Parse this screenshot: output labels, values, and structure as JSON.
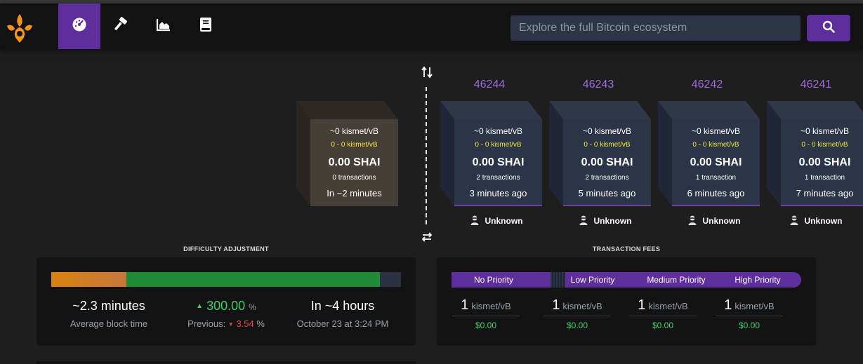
{
  "nav": {
    "items": [
      {
        "name": "dashboard-nav-button",
        "icon": "gauge-icon",
        "active": true
      },
      {
        "name": "mining-nav-button",
        "icon": "hammer-icon",
        "active": false
      },
      {
        "name": "graphs-nav-button",
        "icon": "chart-area-icon",
        "active": false
      },
      {
        "name": "docs-nav-button",
        "icon": "book-icon",
        "active": false
      }
    ],
    "accent": "#5e2f9c"
  },
  "search": {
    "placeholder": "Explore the full Bitcoin ecosystem"
  },
  "pending_block": {
    "fee": "~0 kismet/vB",
    "range": "0 - 0 kismet/vB",
    "amount": "0.00 SHAI",
    "txs": "0 transactions",
    "time": "In ~2 minutes"
  },
  "blocks": [
    {
      "height": "46244",
      "fee": "~0 kismet/vB",
      "range": "0 - 0 kismet/vB",
      "amount": "0.00 SHAI",
      "txs": "2 transactions",
      "time": "3 minutes ago",
      "miner": "Unknown"
    },
    {
      "height": "46243",
      "fee": "~0 kismet/vB",
      "range": "0 - 0 kismet/vB",
      "amount": "0.00 SHAI",
      "txs": "2 transactions",
      "time": "5 minutes ago",
      "miner": "Unknown"
    },
    {
      "height": "46242",
      "fee": "~0 kismet/vB",
      "range": "0 - 0 kismet/vB",
      "amount": "0.00 SHAI",
      "txs": "1 transaction",
      "time": "6 minutes ago",
      "miner": "Unknown"
    },
    {
      "height": "46241",
      "fee": "~0 kismet/vB",
      "range": "0 - 0 kismet/vB",
      "amount": "0.00 SHAI",
      "txs": "1 transaction",
      "time": "7 minutes ago",
      "miner": "Unknown"
    }
  ],
  "difficulty": {
    "title": "DIFFICULTY ADJUSTMENT",
    "progress": {
      "elapsed_fraction": 0.215,
      "blocks_fraction": 0.94
    },
    "avg_block_time": "~2.3 minutes",
    "avg_block_time_label": "Average block time",
    "change": "300.00",
    "change_unit": "%",
    "previous_label": "Previous:",
    "previous_value": "3.54",
    "previous_unit": "%",
    "eta": "In ~4 hours",
    "eta_date": "October 23 at 3:24 PM",
    "colors": {
      "up": "#3bd16f",
      "down": "#e04a4a",
      "elapsed": "#d9820f",
      "mined": "#1f8b34"
    }
  },
  "fees": {
    "title": "TRANSACTION FEES",
    "labels": [
      "No Priority",
      "Low Priority",
      "Medium Priority",
      "High Priority"
    ],
    "low": {
      "value": "1",
      "unit": "kismet/vB",
      "usd": "$0.00"
    },
    "medium": {
      "value": "1",
      "unit": "kismet/vB",
      "usd": "$0.00"
    },
    "high": {
      "value": "1",
      "unit": "kismet/vB",
      "usd": "$0.00"
    },
    "economy": {
      "value": "1",
      "unit": "kismet/vB",
      "usd": "$0.00"
    }
  }
}
